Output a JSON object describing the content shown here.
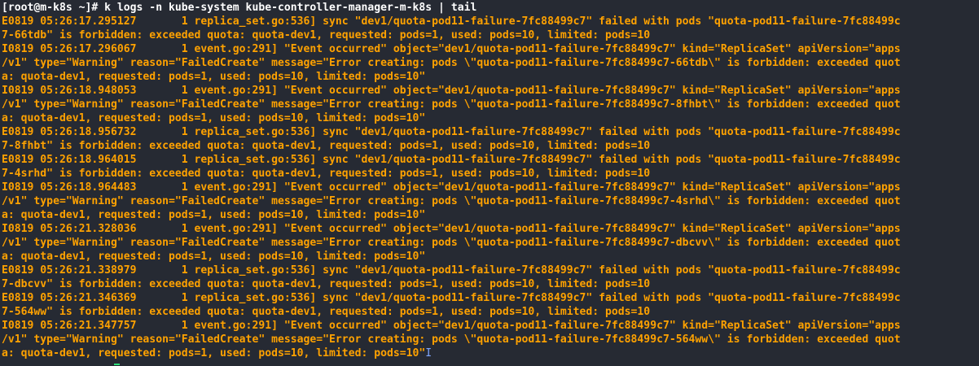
{
  "terminal": {
    "prompt": "[root@m-k8s ~]# k logs -n kube-system kube-controller-manager-m-k8s | tail",
    "lines": [
      "E0819 05:26:17.295127       1 replica_set.go:536] sync \"dev1/quota-pod11-failure-7fc88499c7\" failed with pods \"quota-pod11-failure-7fc88499c",
      "7-66tdb\" is forbidden: exceeded quota: quota-dev1, requested: pods=1, used: pods=10, limited: pods=10",
      "I0819 05:26:17.296067       1 event.go:291] \"Event occurred\" object=\"dev1/quota-pod11-failure-7fc88499c7\" kind=\"ReplicaSet\" apiVersion=\"apps",
      "/v1\" type=\"Warning\" reason=\"FailedCreate\" message=\"Error creating: pods \\\"quota-pod11-failure-7fc88499c7-66tdb\\\" is forbidden: exceeded quot",
      "a: quota-dev1, requested: pods=1, used: pods=10, limited: pods=10\"",
      "I0819 05:26:18.948053       1 event.go:291] \"Event occurred\" object=\"dev1/quota-pod11-failure-7fc88499c7\" kind=\"ReplicaSet\" apiVersion=\"apps",
      "/v1\" type=\"Warning\" reason=\"FailedCreate\" message=\"Error creating: pods \\\"quota-pod11-failure-7fc88499c7-8fhbt\\\" is forbidden: exceeded quot",
      "a: quota-dev1, requested: pods=1, used: pods=10, limited: pods=10\"",
      "E0819 05:26:18.956732       1 replica_set.go:536] sync \"dev1/quota-pod11-failure-7fc88499c7\" failed with pods \"quota-pod11-failure-7fc88499c",
      "7-8fhbt\" is forbidden: exceeded quota: quota-dev1, requested: pods=1, used: pods=10, limited: pods=10",
      "E0819 05:26:18.964015       1 replica_set.go:536] sync \"dev1/quota-pod11-failure-7fc88499c7\" failed with pods \"quota-pod11-failure-7fc88499c",
      "7-4srhd\" is forbidden: exceeded quota: quota-dev1, requested: pods=1, used: pods=10, limited: pods=10",
      "I0819 05:26:18.964483       1 event.go:291] \"Event occurred\" object=\"dev1/quota-pod11-failure-7fc88499c7\" kind=\"ReplicaSet\" apiVersion=\"apps",
      "/v1\" type=\"Warning\" reason=\"FailedCreate\" message=\"Error creating: pods \\\"quota-pod11-failure-7fc88499c7-4srhd\\\" is forbidden: exceeded quot",
      "a: quota-dev1, requested: pods=1, used: pods=10, limited: pods=10\"",
      "I0819 05:26:21.328036       1 event.go:291] \"Event occurred\" object=\"dev1/quota-pod11-failure-7fc88499c7\" kind=\"ReplicaSet\" apiVersion=\"apps",
      "/v1\" type=\"Warning\" reason=\"FailedCreate\" message=\"Error creating: pods \\\"quota-pod11-failure-7fc88499c7-dbcvv\\\" is forbidden: exceeded quot",
      "a: quota-dev1, requested: pods=1, used: pods=10, limited: pods=10\"",
      "E0819 05:26:21.338979       1 replica_set.go:536] sync \"dev1/quota-pod11-failure-7fc88499c7\" failed with pods \"quota-pod11-failure-7fc88499c",
      "7-dbcvv\" is forbidden: exceeded quota: quota-dev1, requested: pods=1, used: pods=10, limited: pods=10",
      "E0819 05:26:21.346369       1 replica_set.go:536] sync \"dev1/quota-pod11-failure-7fc88499c7\" failed with pods \"quota-pod11-failure-7fc88499c",
      "7-564ww\" is forbidden: exceeded quota: quota-dev1, requested: pods=1, used: pods=10, limited: pods=10",
      "I0819 05:26:21.347757       1 event.go:291] \"Event occurred\" object=\"dev1/quota-pod11-failure-7fc88499c7\" kind=\"ReplicaSet\" apiVersion=\"apps",
      "/v1\" type=\"Warning\" reason=\"FailedCreate\" message=\"Error creating: pods \\\"quota-pod11-failure-7fc88499c7-564ww\\\" is forbidden: exceeded quot",
      "a: quota-dev1, requested: pods=1, used: pods=10, limited: pods=10\""
    ],
    "cursor_glyph": "I",
    "colors": {
      "background": "#262a33",
      "prompt_text": "#ffffff",
      "log_text": "#ffa200",
      "cursor": "#7fa7ff",
      "caret_mark": "#2ee07a"
    }
  }
}
